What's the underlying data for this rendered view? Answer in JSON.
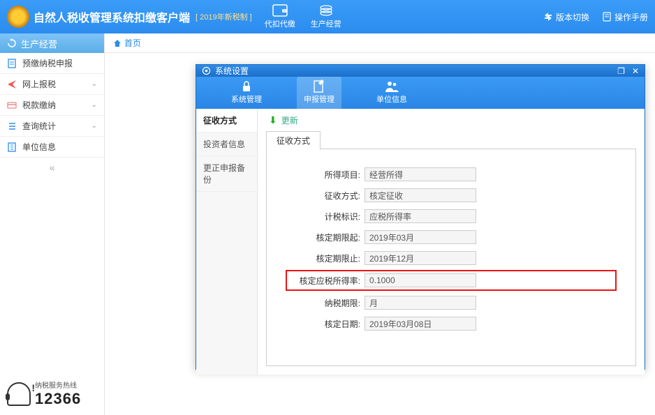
{
  "header": {
    "title": "自然人税收管理系统扣缴客户端",
    "subtitle": "[ 2019年新税制 ]",
    "nav": [
      {
        "label": "代扣代缴"
      },
      {
        "label": "生产经营"
      }
    ],
    "right": [
      {
        "label": "版本切换"
      },
      {
        "label": "操作手册"
      }
    ]
  },
  "breadcrumb": {
    "home": "首页"
  },
  "sidebar": {
    "header": "生产经营",
    "items": [
      {
        "label": "预缴纳税申报",
        "expandable": false
      },
      {
        "label": "网上报税",
        "expandable": true
      },
      {
        "label": "税款缴纳",
        "expandable": true
      },
      {
        "label": "查询统计",
        "expandable": true
      },
      {
        "label": "单位信息",
        "expandable": false
      }
    ]
  },
  "dialog": {
    "title": "系统设置",
    "tabs": [
      {
        "label": "系统管理"
      },
      {
        "label": "申报管理"
      },
      {
        "label": "单位信息"
      }
    ],
    "left_nav": [
      {
        "label": "征收方式"
      },
      {
        "label": "投资者信息"
      },
      {
        "label": "更正申报备份"
      }
    ],
    "update_label": "更新",
    "inner_tab": "征收方式",
    "form": {
      "rows": [
        {
          "label": "所得项目:",
          "value": "经营所得"
        },
        {
          "label": "征收方式:",
          "value": "核定征收"
        },
        {
          "label": "计税标识:",
          "value": "应税所得率"
        },
        {
          "label": "核定期限起:",
          "value": "2019年03月"
        },
        {
          "label": "核定期限止:",
          "value": "2019年12月"
        },
        {
          "label": "核定应税所得率:",
          "value": "0.1000",
          "highlight": true
        },
        {
          "label": "纳税期限:",
          "value": "月"
        },
        {
          "label": "核定日期:",
          "value": "2019年03月08日"
        }
      ]
    }
  },
  "hotline": {
    "label": "纳税服务热线",
    "number": "12366"
  }
}
